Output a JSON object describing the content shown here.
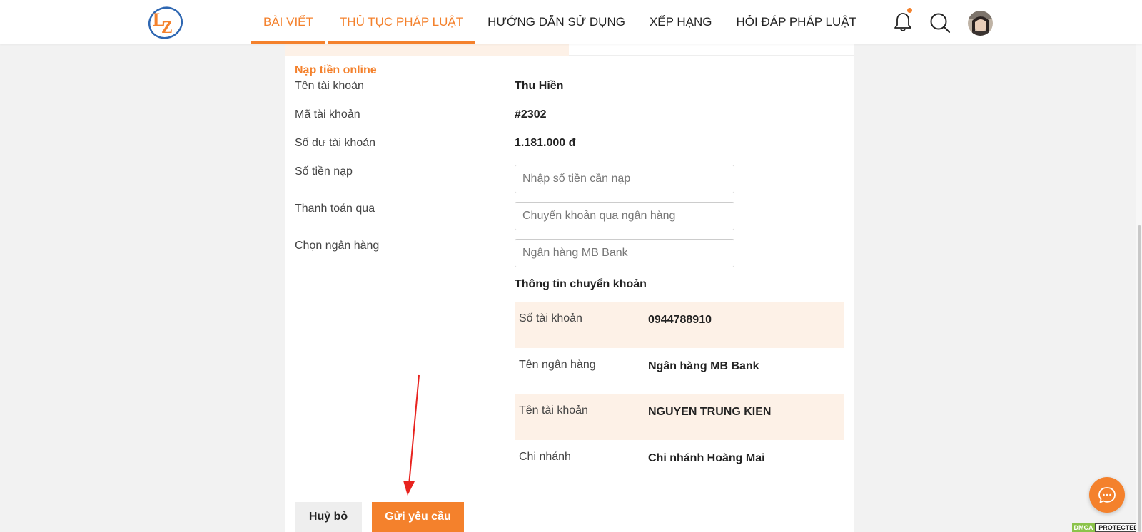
{
  "nav": {
    "items": [
      {
        "label": "BÀI VIẾT"
      },
      {
        "label": "THỦ TỤC PHÁP LUẬT"
      },
      {
        "label": "HƯỚNG DẪN SỬ DỤNG"
      },
      {
        "label": "XẾP HẠNG"
      },
      {
        "label": "HỎI ĐÁP PHÁP LUẬT"
      }
    ],
    "active_color": "#f4812c"
  },
  "header_icons": [
    "bell-icon",
    "search-icon",
    "avatar"
  ],
  "form": {
    "title": "Nạp tiền online",
    "account_name_label": "Tên tài khoản",
    "account_name_value": "Thu Hiền",
    "account_id_label": "Mã tài khoản",
    "account_id_value": "#2302",
    "balance_label": "Số dư tài khoản",
    "balance_value": "1.181.000 đ",
    "amount_label": "Số tiền nạp",
    "amount_placeholder": "Nhập số tiền cần nạp",
    "payment_label": "Thanh toán qua",
    "payment_placeholder": "Chuyển khoản qua ngân hàng",
    "bank_label": "Chọn ngân hàng",
    "bank_placeholder": "Ngân hàng MB Bank"
  },
  "transfer_info": {
    "title": "Thông tin chuyển khoản",
    "rows": [
      {
        "key": "Số tài khoản",
        "value": "0944788910"
      },
      {
        "key": "Tên ngân hàng",
        "value": "Ngân hàng MB Bank"
      },
      {
        "key": "Tên tài khoản",
        "value": "NGUYEN TRUNG KIEN"
      },
      {
        "key": "Chi nhánh",
        "value": "Chi nhánh Hoàng Mai"
      }
    ]
  },
  "buttons": {
    "cancel": "Huỷ bỏ",
    "submit": "Gửi yêu cầu"
  },
  "badges": {
    "dmca_left": "DMCA",
    "dmca_right": "PROTECTED"
  },
  "colors": {
    "accent": "#f4812c",
    "row_shade": "#fdf1e7"
  }
}
